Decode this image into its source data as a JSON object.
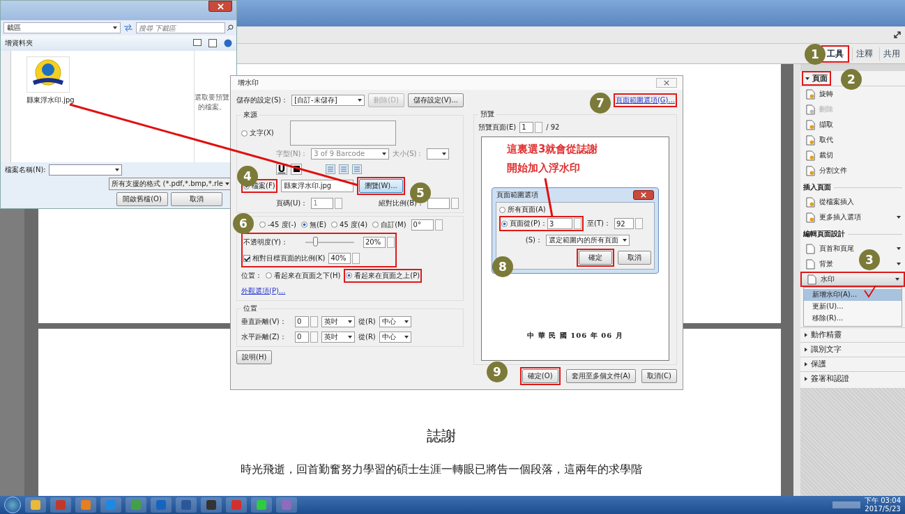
{
  "app": {
    "tabs": [
      {
        "label": "工具",
        "selected": true
      },
      {
        "label": "注釋",
        "selected": false
      },
      {
        "label": "共用",
        "selected": false
      }
    ]
  },
  "document": {
    "heading": "誌謝",
    "paragraph": "時光飛逝，回首勤奮努力學習的碩士生涯一轉眼已將告一個段落，這兩年的求學階"
  },
  "tools_panel": {
    "section": {
      "label": "頁面",
      "expanded": true
    },
    "groups": [
      {
        "items": [
          {
            "label": "旋轉",
            "disabled": false,
            "menu": false,
            "selected": false
          },
          {
            "label": "刪除",
            "disabled": true,
            "menu": false,
            "selected": false
          },
          {
            "label": "擷取",
            "disabled": false,
            "menu": false,
            "selected": false
          },
          {
            "label": "取代",
            "disabled": false,
            "menu": false,
            "selected": false
          },
          {
            "label": "裁切",
            "disabled": false,
            "menu": false,
            "selected": false
          },
          {
            "label": "分割文件",
            "disabled": false,
            "menu": false,
            "selected": false
          }
        ]
      },
      {
        "heading": "插入頁面",
        "items": [
          {
            "label": "從檔案插入",
            "disabled": false,
            "menu": false,
            "selected": false
          },
          {
            "label": "更多插入選項",
            "disabled": false,
            "menu": true,
            "selected": false
          }
        ]
      },
      {
        "heading": "編輯頁面設計",
        "items": [
          {
            "label": "頁首和頁尾",
            "disabled": false,
            "menu": true,
            "selected": false
          },
          {
            "label": "背景",
            "disabled": false,
            "menu": true,
            "selected": false
          },
          {
            "label": "水印",
            "disabled": false,
            "menu": true,
            "selected": true
          }
        ]
      }
    ],
    "submenu": [
      {
        "label": "新增水印(A)...",
        "selected": true
      },
      {
        "label": "更新(U)...",
        "selected": false
      },
      {
        "label": "移除(R)...",
        "selected": false
      }
    ],
    "collapsed_sections": [
      "動作精靈",
      "識別文字",
      "保護",
      "簽署和認證"
    ]
  },
  "file_dialog": {
    "location": "載區",
    "search_placeholder": "搜尋 下載區",
    "toolbar_label": "增資料夾",
    "file_name": "縣東浮水印.jpg",
    "preview_hint": "選取要預覽的檔案。",
    "filename_label": "檔案名稱(N):",
    "filetype": "所有支援的格式 (*.pdf,*.bmp,*.rle",
    "buttons": [
      "開啟舊檔(O)",
      "取消"
    ]
  },
  "watermark_dialog": {
    "title": "增水印",
    "saved_label": "儲存的設定(S)：",
    "saved_value": "[自訂-未儲存]",
    "delete_button": "刪除(D)",
    "save_button": "儲存設定(V)...",
    "source": {
      "heading": "來源",
      "options": [
        {
          "label": "文字(X)",
          "selected": false
        },
        {
          "label": "檔案(F)",
          "selected": true
        }
      ],
      "font_label": "字型(N)：",
      "font_value": "3 of 9 Barcode",
      "size_label": "大小(S)：",
      "underline_button": "U",
      "file_value": "縣東浮水印.jpg",
      "browse_button": "瀏覽(W)...",
      "page_label": "頁碼(U)：",
      "page_value": "1",
      "scale_label": "絕對比例(B)："
    },
    "appearance": {
      "rotation": [
        {
          "label": "-45 度(-)",
          "selected": false
        },
        {
          "label": "無(E)",
          "selected": true
        },
        {
          "label": "45 度(4)",
          "selected": false
        },
        {
          "label": "自訂(M)",
          "selected": false
        }
      ],
      "rotation_value": "0°",
      "opacity_label": "不透明度(Y)：",
      "opacity": {
        "level": 0.2
      },
      "opacity_value": "20%",
      "scale_checkbox": {
        "label": "相對目標頁面的比例(K)",
        "checked": true
      },
      "scale_value": "40%",
      "position_label": "位置：",
      "layers": [
        {
          "label": "看起來在頁面之下(H)",
          "selected": false
        },
        {
          "label": "看起來在頁面之上(P)",
          "selected": true
        }
      ],
      "link": "外觀選項(P)..."
    },
    "placement": {
      "heading": "位置",
      "rows": [
        {
          "label": "垂直距離(V)：",
          "value": "0",
          "unit": "英吋",
          "from_label": "從(R)",
          "from_value": "中心"
        },
        {
          "label": "水平距離(Z)：",
          "value": "0",
          "unit": "英吋",
          "from_label": "從(R)",
          "from_value": "中心"
        }
      ]
    },
    "help_button": "說明(H)",
    "range_link": "頁面範圍選項(G)...",
    "preview": {
      "heading": "預覽",
      "page_label": "預覽頁面(E)",
      "page_value": "1",
      "page_total": "/ 92",
      "sample_text": "中 華 民 國 106 年 06 月"
    },
    "buttons": [
      "確定(O)",
      "套用至多個文件(A)",
      "取消(C)"
    ]
  },
  "range_dialog": {
    "title": "頁面範圍選項",
    "options": [
      {
        "label": "所有頁面(A)",
        "selected": false
      },
      {
        "label": "頁面從(P)：",
        "selected": true
      }
    ],
    "from_value": "3",
    "to_label": "至(T)：",
    "to_value": "92",
    "subset_label": "(S)：",
    "subset_value": "選定範圍內的所有頁面",
    "buttons": [
      "確定",
      "取消"
    ]
  },
  "annotation": {
    "lines": [
      "這裏選3就會從誌謝",
      "開始加入浮水印"
    ],
    "steps": [
      "1",
      "2",
      "3",
      "4",
      "5",
      "6",
      "7",
      "8",
      "9"
    ]
  },
  "taskbar": {
    "time": "下午 03:04",
    "date": "2017/5/23"
  }
}
